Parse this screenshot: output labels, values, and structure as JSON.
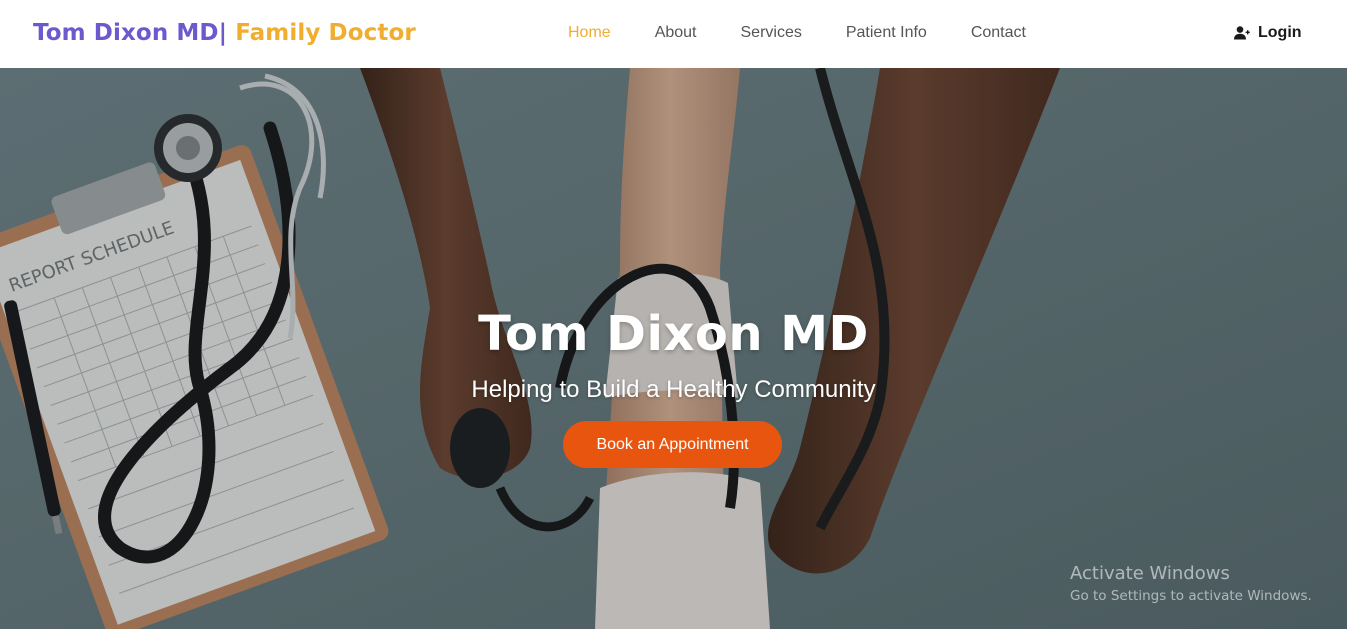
{
  "brand": {
    "name": "Tom Dixon MD|",
    "tagline": " Family Doctor",
    "name_color": "#6a5acd",
    "tagline_color": "#f0ad2e"
  },
  "nav": {
    "items": [
      {
        "label": "Home",
        "active": true
      },
      {
        "label": "About",
        "active": false
      },
      {
        "label": "Services",
        "active": false
      },
      {
        "label": "Patient Info",
        "active": false
      },
      {
        "label": "Contact",
        "active": false
      }
    ],
    "login_label": "Login",
    "login_icon": "user-plus-icon"
  },
  "hero": {
    "title": "Tom Dixon MD",
    "subtitle": "Helping to Build a Healthy Community",
    "cta_label": "Book an Appointment",
    "cta_color": "#e8550f",
    "image_subject": "doctor measuring blood pressure with stethoscope and report schedule clipboard",
    "clipboard_text": "REPORT SCHEDULE"
  },
  "watermark": {
    "line1": "Activate Windows",
    "line2": "Go to Settings to activate Windows."
  }
}
